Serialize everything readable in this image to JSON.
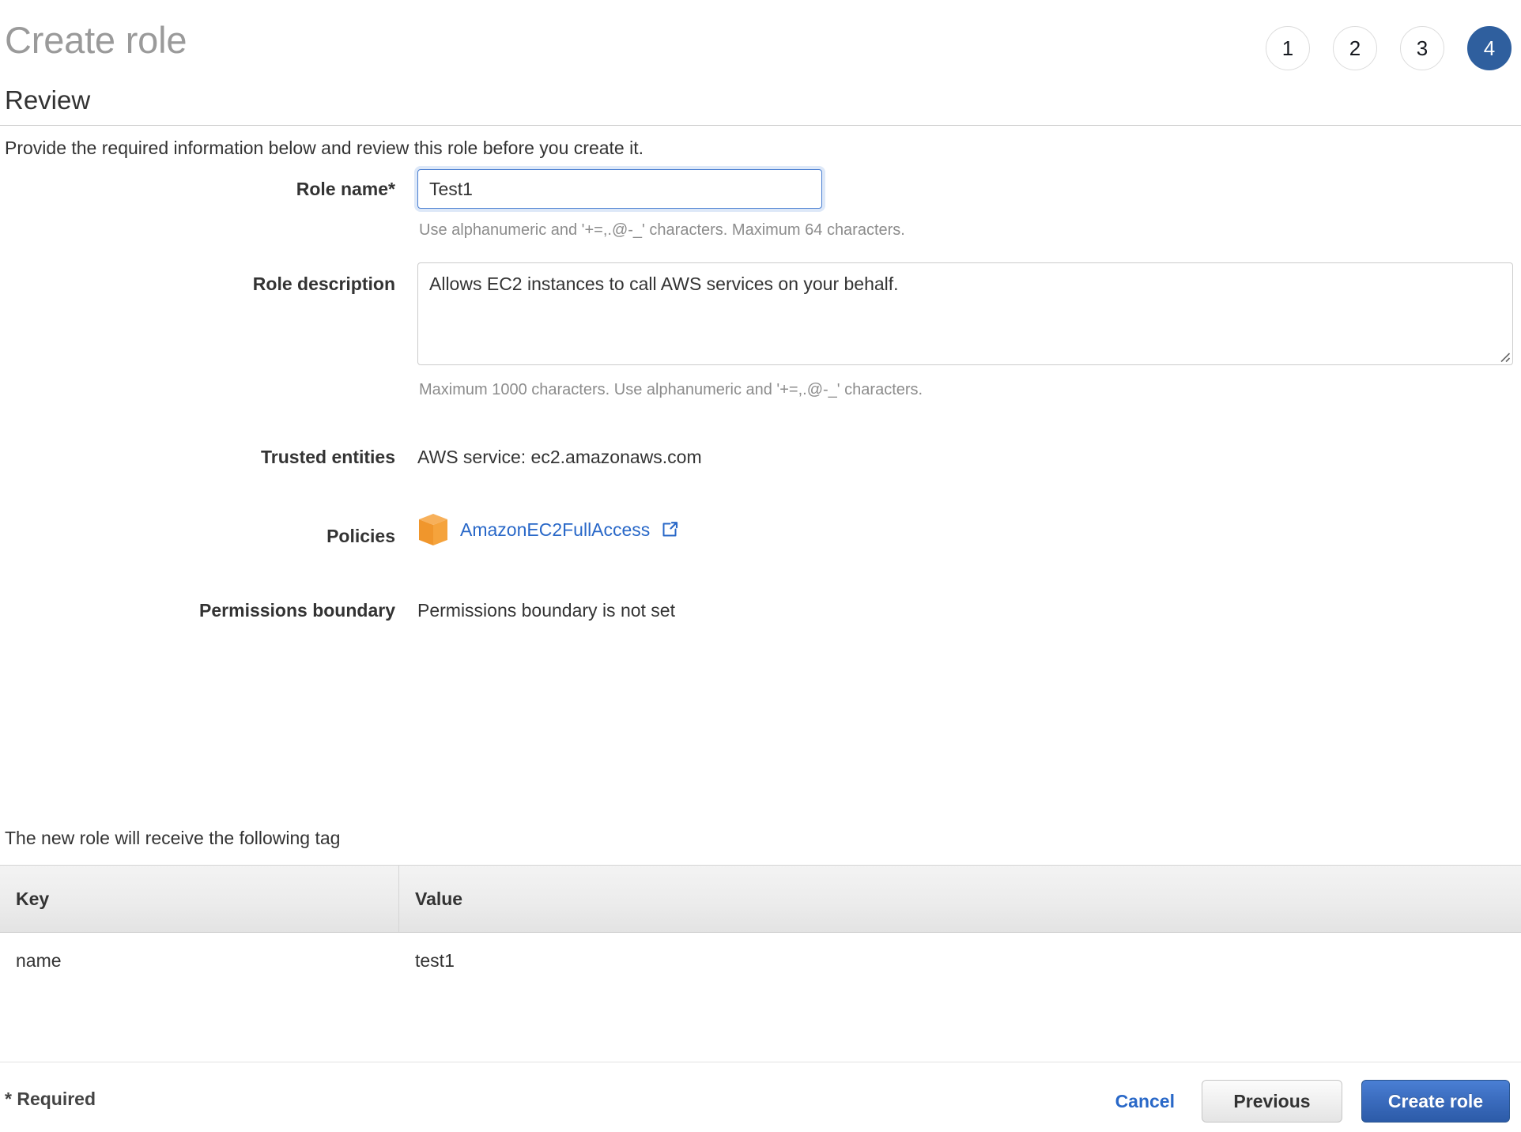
{
  "header": {
    "title": "Create role",
    "steps": [
      {
        "label": "1",
        "active": false
      },
      {
        "label": "2",
        "active": false
      },
      {
        "label": "3",
        "active": false
      },
      {
        "label": "4",
        "active": true
      }
    ],
    "active_step_color": "#2f5f9e"
  },
  "section": {
    "title": "Review",
    "intro": "Provide the required information below and review this role before you create it."
  },
  "form": {
    "role_name": {
      "label": "Role name*",
      "value": "Test1",
      "placeholder": "",
      "helper": "Use alphanumeric and '+=,.@-_' characters. Maximum 64 characters."
    },
    "role_description": {
      "label": "Role description",
      "value": "Allows EC2 instances to call AWS services on your behalf.",
      "placeholder": "",
      "helper": "Maximum 1000 characters. Use alphanumeric and '+=,.@-_' characters."
    },
    "trusted_entities": {
      "label": "Trusted entities",
      "value": "AWS service: ec2.amazonaws.com"
    },
    "policies": {
      "label": "Policies",
      "icon": "policy-cube-icon",
      "icon_color": "#f5a33c",
      "link_label": "AmazonEC2FullAccess",
      "link_color": "#2968c8",
      "external_icon": "external-link-icon"
    },
    "permissions_boundary": {
      "label": "Permissions boundary",
      "value": "Permissions boundary is not set"
    }
  },
  "tags": {
    "note": "The new role will receive the following tag",
    "columns": [
      "Key",
      "Value"
    ],
    "rows": [
      {
        "key": "name",
        "value": "test1"
      }
    ]
  },
  "footer": {
    "required_note": "* Required",
    "cancel_label": "Cancel",
    "previous_label": "Previous",
    "create_label": "Create role",
    "primary_color": "#3a6bbd"
  }
}
